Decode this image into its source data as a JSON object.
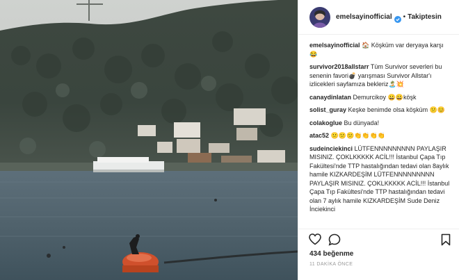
{
  "header": {
    "username": "emelsayinofficial",
    "follow_status": "Takiptesin",
    "dot": "•"
  },
  "caption": {
    "username": "emelsayinofficial",
    "text": "🏠 Köşküm var deryaya karşı 😂"
  },
  "comments": [
    {
      "username": "survivor2018allstarr",
      "text": "Tüm Survivor severleri bu senenin favori💣 yarışması Survivor Allstar'ı izlicekleri sayfamıza bekleriz🏝️💥"
    },
    {
      "username": "canaydinlatan",
      "text": "Demurcikoy 😀😀köşk"
    },
    {
      "username": "solist_guray",
      "text": "Keşke benimde olsa köşküm 😕😊"
    },
    {
      "username": "colakoglue",
      "text": "Bu dünyada!"
    },
    {
      "username": "atac52",
      "text": "😕😕😕👏👏👏👏"
    },
    {
      "username": "sudeinciekinci",
      "text": "LÜTFENNNNNNNNN PAYLAŞIR MISINIZ. ÇOKLKKKKK ACİL!!! İstanbul Çapa Tıp Fakültesi'nde TTP hastalığından tedavi olan 8aylık hamile KIZKARDEŞİM LÜTFENNNNNNNNN PAYLAŞIR MISINIZ. ÇOKLKKKKK ACİL!!! İstanbul Çapa Tıp Fakültesi'nde TTP hastalığından tedavi olan 7 aylık hamile KIZKARDEŞİM Sude Deniz İnciekinci"
    }
  ],
  "likes": "434 beğenme",
  "timestamp": "11 DAKİKA ÖNCE",
  "icons": {
    "verified": "verified-badge-icon",
    "like": "heart-icon",
    "comment": "comment-bubble-icon",
    "save": "bookmark-icon"
  },
  "colors": {
    "verified": "#3897f0",
    "text": "#262626",
    "muted": "#999999"
  }
}
